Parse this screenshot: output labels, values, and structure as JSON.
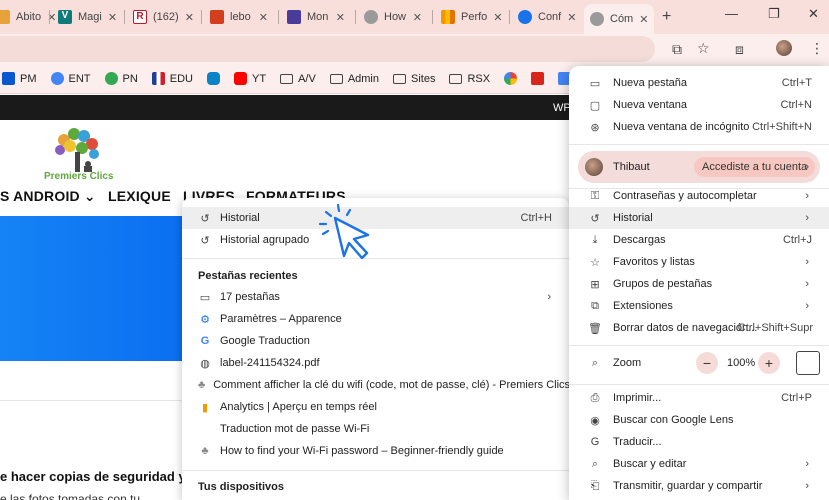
{
  "tabs": [
    {
      "label": "Abito",
      "color": "#e8a23c"
    },
    {
      "label": "Magi",
      "color": "#0f7b7b"
    },
    {
      "label": "(162)",
      "color": "#c0182a"
    },
    {
      "label": "lebo",
      "color": "#d13f1f"
    },
    {
      "label": "Mon",
      "color": "#4a3d9a"
    },
    {
      "label": "How",
      "color": "#777777"
    },
    {
      "label": "Perfo",
      "color": "#f29900"
    },
    {
      "label": "Conf",
      "color": "#1a73e8"
    },
    {
      "label": "Cóm",
      "color": "#777777",
      "active": true
    }
  ],
  "bookmarks": [
    {
      "label": "PM",
      "color": "#0b57d0"
    },
    {
      "label": "ENT",
      "color": "#4285f4"
    },
    {
      "label": "PN",
      "color": "#34a853"
    },
    {
      "label": "EDU",
      "color": "#1d3f96"
    },
    {
      "label": "",
      "color": "#0a84c6"
    },
    {
      "label": "YT",
      "color": "#ff0000"
    },
    {
      "label": "A/V",
      "folder": true
    },
    {
      "label": "Admin",
      "folder": true
    },
    {
      "label": "Sites",
      "folder": true
    },
    {
      "label": "RSX",
      "folder": true
    },
    {
      "label": "",
      "color": "#e94f8a"
    },
    {
      "label": "",
      "color": "#d9261c"
    },
    {
      "label": "GT",
      "color": "#4285f4"
    }
  ],
  "page": {
    "admin_bar_text": "WP",
    "logo_text": "Premiers Clics",
    "nav": [
      "S ANDROID ⌄",
      "LEXIQUE",
      "LIVRES",
      "FORMATEURS"
    ],
    "heading": "e hacer copias de seguridad y",
    "subtext": "e las fotos tomadas con tu"
  },
  "history_menu": {
    "items": [
      {
        "icon": "↺",
        "label": "Historial",
        "shortcut": "Ctrl+H",
        "highlight": true
      },
      {
        "icon": "↺",
        "label": "Historial agrupado"
      }
    ],
    "recent_tabs_heading": "Pestañas recientes",
    "recent": [
      {
        "icon": "▭",
        "label": "17 pestañas",
        "arrow": true
      },
      {
        "icon": "⚙",
        "label": "Paramètres – Apparence"
      },
      {
        "icon": "G",
        "label": "Google Traduction"
      },
      {
        "icon": "◍",
        "label": "label-241154324.pdf"
      },
      {
        "icon": "♣",
        "label": "Comment afficher la clé du wifi (code, mot de passe, clé) - Premiers Clics"
      },
      {
        "icon": "▮",
        "label": "Analytics | Aperçu en temps réel"
      },
      {
        "icon": "",
        "label": "Traduction mot de passe Wi-Fi"
      },
      {
        "icon": "♣",
        "label": "How to find your Wi-Fi password – Beginner-friendly guide"
      }
    ],
    "devices_heading": "Tus dispositivos"
  },
  "chrome_menu": {
    "top": [
      {
        "icon": "▭",
        "label": "Nueva pestaña",
        "shortcut": "Ctrl+T"
      },
      {
        "icon": "▢",
        "label": "Nueva ventana",
        "shortcut": "Ctrl+N"
      },
      {
        "icon": "⊛",
        "label": "Nueva ventana de incógnito",
        "shortcut": "Ctrl+Shift+N"
      }
    ],
    "profile": {
      "name": "Thibaut",
      "action": "Accediste a tu cuenta"
    },
    "mid": [
      {
        "icon": "⚿",
        "label": "Contraseñas y autocompletar",
        "arrow": true
      },
      {
        "icon": "↺",
        "label": "Historial",
        "arrow": true,
        "highlight": true
      },
      {
        "icon": "⤓",
        "label": "Descargas",
        "shortcut": "Ctrl+J"
      },
      {
        "icon": "☆",
        "label": "Favoritos y listas",
        "arrow": true
      },
      {
        "icon": "⊞",
        "label": "Grupos de pestañas",
        "arrow": true
      },
      {
        "icon": "⧉",
        "label": "Extensiones",
        "arrow": true
      },
      {
        "icon": "🗑",
        "label": "Borrar datos de navegación...",
        "shortcut": "Ctrl+Shift+Supr"
      }
    ],
    "zoom": {
      "label": "Zoom",
      "value": "100%"
    },
    "bottom": [
      {
        "icon": "⎙",
        "label": "Imprimir...",
        "shortcut": "Ctrl+P"
      },
      {
        "icon": "◉",
        "label": "Buscar con Google Lens"
      },
      {
        "icon": "G",
        "label": "Traducir..."
      },
      {
        "icon": "⌕",
        "label": "Buscar y editar",
        "arrow": true
      },
      {
        "icon": "⎗",
        "label": "Transmitir, guardar y compartir",
        "arrow": true
      }
    ]
  }
}
